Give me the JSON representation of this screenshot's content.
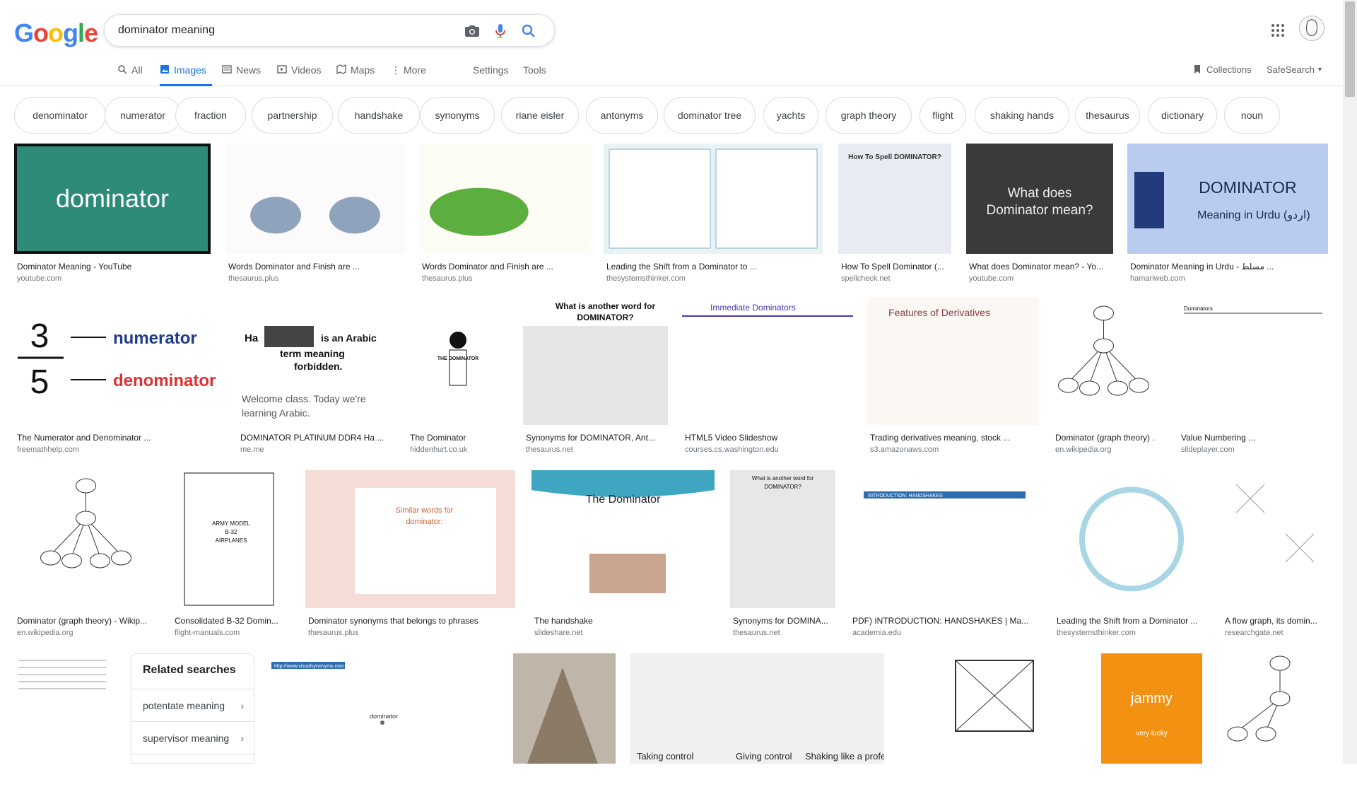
{
  "logo": {
    "letters": [
      "G",
      "o",
      "o",
      "g",
      "l",
      "e"
    ],
    "colors": [
      "#4285f4",
      "#ea4335",
      "#fbbc05",
      "#4285f4",
      "#34a853",
      "#ea4335"
    ]
  },
  "search": {
    "query": "dominator meaning",
    "camera_icon": "camera-icon",
    "mic_icon": "mic-icon",
    "search_icon": "search-icon"
  },
  "tabs": {
    "all": "All",
    "images": "Images",
    "news": "News",
    "videos": "Videos",
    "maps": "Maps",
    "more": "More",
    "settings": "Settings",
    "tools": "Tools",
    "collections": "Collections",
    "safesearch": "SafeSearch"
  },
  "chips": [
    "denominator",
    "numerator",
    "fraction",
    "partnership",
    "handshake",
    "synonyms",
    "riane eisler",
    "antonyms",
    "dominator tree",
    "yachts",
    "graph theory",
    "flight",
    "shaking hands",
    "thesaurus",
    "dictionary",
    "noun"
  ],
  "results": [
    {
      "title": "Dominator Meaning - YouTube",
      "source": "youtube.com",
      "img_text": "dominator"
    },
    {
      "title": "Words Dominator and Finish are ...",
      "source": "thesaurus.plus",
      "img_text": ""
    },
    {
      "title": "Words Dominator and Finish are ...",
      "source": "thesaurus.plus",
      "img_text": ""
    },
    {
      "title": "Leading the Shift from a Dominator to ...",
      "source": "thesystemsthinker.com",
      "img_text": ""
    },
    {
      "title": "How To Spell Dominator (...",
      "source": "spellcheck.net",
      "img_text": "How To Spell DOMINATOR?"
    },
    {
      "title": "What does Dominator mean? - Yo...",
      "source": "youtube.com",
      "img_text": "What does Dominator mean?"
    },
    {
      "title": "Dominator Meaning in Urdu - مسلط ...",
      "source": "hamariweb.com",
      "img_text": "DOMINATOR",
      "img_sub": "Meaning in Urdu (اردو)"
    },
    {
      "title": "The Numerator and Denominator ...",
      "source": "freemathhelp.com",
      "img_num": "numerator",
      "img_den": "denominator",
      "img_top": "3",
      "img_bot": "5"
    },
    {
      "title": "DOMINATOR PLATINUM DDR4 Ha ...",
      "source": "me.me",
      "img_text": "is an Arabic term meaning forbidden.",
      "img_sub": "Welcome class. Today we're learning Arabic.",
      "img_ha": "Ha"
    },
    {
      "title": "The Dominator",
      "source": "hiddenhurt.co.uk",
      "img_text": "THE DOMINATOR"
    },
    {
      "title": "Synonyms for DOMINATOR, Ant...",
      "source": "thesaurus.net",
      "img_text": "What is another word for DOMINATOR?"
    },
    {
      "title": "HTML5 Video Slideshow",
      "source": "courses.cs.washington.edu",
      "img_text": "Immediate Dominators"
    },
    {
      "title": "Trading derivatives meaning, stock ...",
      "source": "s3.amazonaws.com",
      "img_text": "Features of Derivatives"
    },
    {
      "title": "Dominator (graph theory) ...",
      "source": "en.wikipedia.org",
      "img_text": ""
    },
    {
      "title": "Value Numbering ...",
      "source": "slideplayer.com",
      "img_text": "Dominators"
    },
    {
      "title": "Dominator (graph theory) - Wikip...",
      "source": "en.wikipedia.org",
      "img_text": ""
    },
    {
      "title": "Consolidated B-32 Domin...",
      "source": "flight-manuals.com",
      "img_text": "ARMY MODEL B-32 AIRPLANES"
    },
    {
      "title": "Dominator synonyms that belongs to phrases",
      "source": "thesaurus.plus",
      "img_text": "Similar words for dominator:"
    },
    {
      "title": "The handshake",
      "source": "slideshare.net",
      "img_text": "The Dominator"
    },
    {
      "title": "Synonyms for DOMINA...",
      "source": "thesaurus.net",
      "img_text": ""
    },
    {
      "title": "PDF) INTRODUCTION: HANDSHAKES | Ma...",
      "source": "academia.edu",
      "img_text": "INTRODUCTION: HANDSHAKES"
    },
    {
      "title": "Leading the Shift from a Dominator ...",
      "source": "thesystemsthinker.com",
      "img_text": ""
    },
    {
      "title": "A flow graph, its domin...",
      "source": "researchgate.net",
      "img_text": ""
    },
    {
      "title": "",
      "source": "",
      "img_text": ""
    },
    {
      "title": "",
      "source": "",
      "img_text": "dominator",
      "img_url": "http://www.visualsynonyms.com"
    },
    {
      "title": "",
      "source": "",
      "img_text": ""
    },
    {
      "title": "",
      "source": "",
      "img_text": "Taking control",
      "img_sub": "Giving control",
      "img_extra": "Shaking like a professional"
    },
    {
      "title": "",
      "source": "",
      "img_text": ""
    },
    {
      "title": "",
      "source": "",
      "img_text": "jammy",
      "img_sub": "very lucky"
    },
    {
      "title": "",
      "source": "",
      "img_text": ""
    }
  ],
  "related": {
    "heading": "Related searches",
    "items": [
      "potentate meaning",
      "supervisor meaning"
    ]
  }
}
